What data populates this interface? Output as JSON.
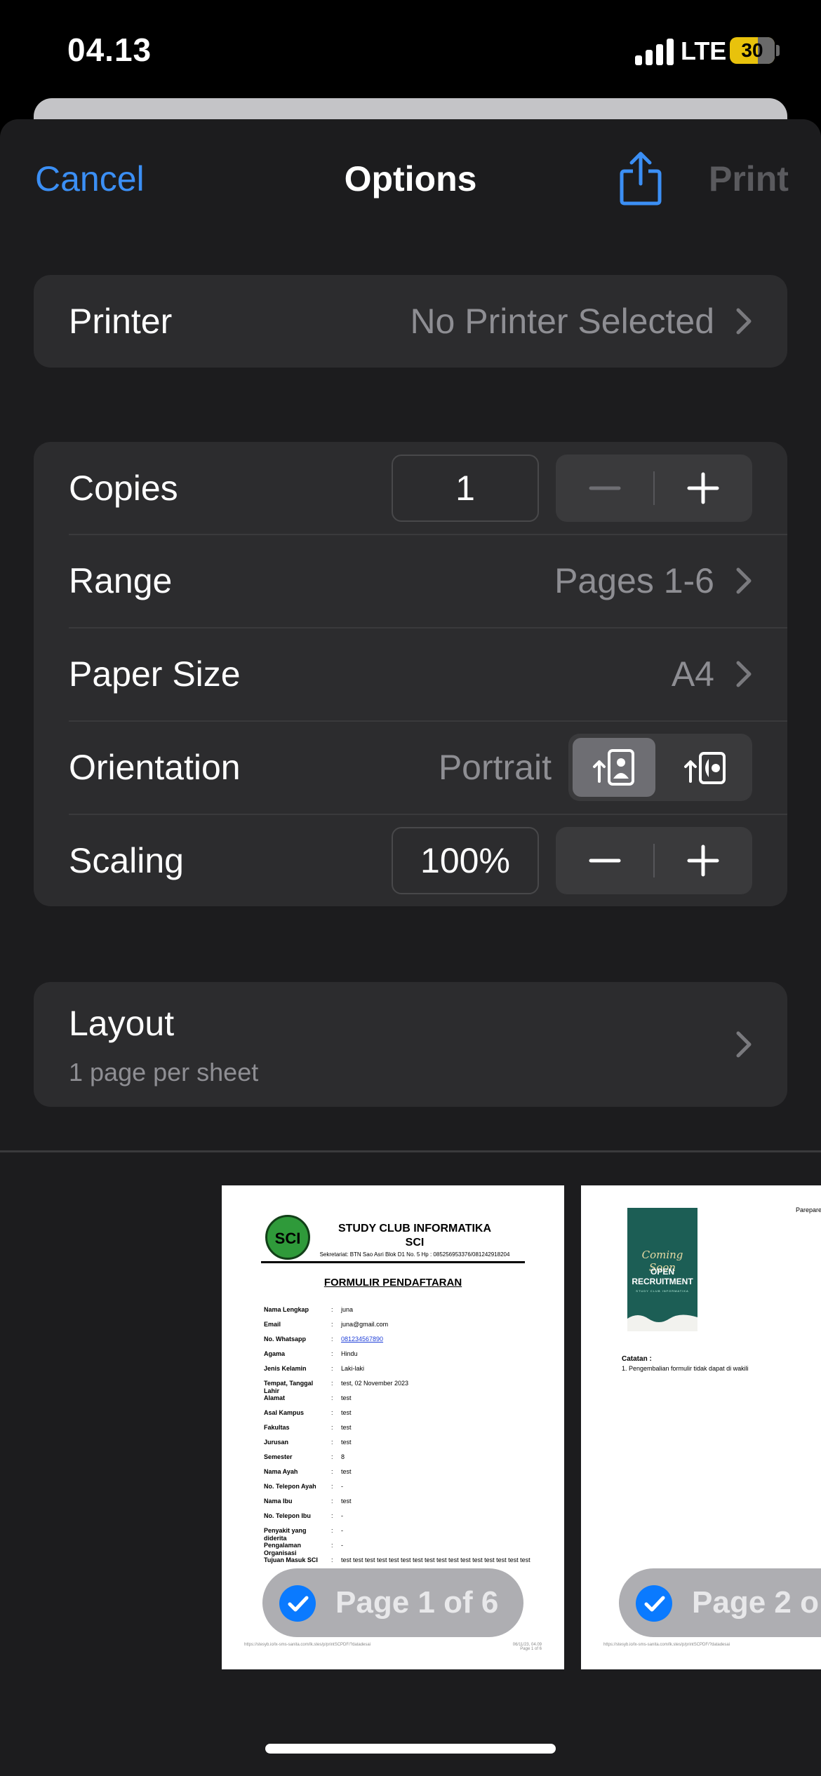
{
  "status_bar": {
    "time": "04.13",
    "network": "LTE",
    "battery": "30"
  },
  "nav": {
    "cancel": "Cancel",
    "title": "Options",
    "share_icon": "share-icon",
    "print": "Print"
  },
  "printer": {
    "label": "Printer",
    "value": "No Printer Selected"
  },
  "options": {
    "copies": {
      "label": "Copies",
      "value": "1"
    },
    "range": {
      "label": "Range",
      "value": "Pages 1-6"
    },
    "paper_size": {
      "label": "Paper Size",
      "value": "A4"
    },
    "orientation": {
      "label": "Orientation",
      "value": "Portrait",
      "selected": "portrait"
    },
    "scaling": {
      "label": "Scaling",
      "value": "100%"
    }
  },
  "layout": {
    "label": "Layout",
    "value": "1 page per sheet"
  },
  "previews": [
    {
      "badge": "Page 1 of 6",
      "org_line1": "STUDY CLUB INFORMATIKA",
      "org_line2": "SCI",
      "logo_text": "SCI",
      "address": "Sekretariat: BTN Sao Asri Blok D1 No. 5 Hp : 085256953376/081242918204",
      "form_title": "FORMULIR PENDAFTARAN",
      "fields": [
        {
          "key": "Nama Lengkap",
          "value": "juna"
        },
        {
          "key": "Email",
          "value": "juna@gmail.com"
        },
        {
          "key": "No. Whatsapp",
          "value": "081234567890"
        },
        {
          "key": "Agama",
          "value": "Hindu"
        },
        {
          "key": "Jenis Kelamin",
          "value": "Laki-laki"
        },
        {
          "key": "Tempat, Tanggal Lahir",
          "value": "test, 02 November 2023"
        },
        {
          "key": "Alamat",
          "value": "test"
        },
        {
          "key": "Asal Kampus",
          "value": "test"
        },
        {
          "key": "Fakultas",
          "value": "test"
        },
        {
          "key": "Jurusan",
          "value": "test"
        },
        {
          "key": "Semester",
          "value": "8"
        },
        {
          "key": "Nama Ayah",
          "value": "test"
        },
        {
          "key": "No. Telepon Ayah",
          "value": "-"
        },
        {
          "key": "Nama Ibu",
          "value": "test"
        },
        {
          "key": "No. Telepon Ibu",
          "value": "-"
        },
        {
          "key": "Penyakit yang diderita",
          "value": "-"
        },
        {
          "key": "Pengalaman Organisasi",
          "value": "-"
        },
        {
          "key": "Tujuan Masuk SCI",
          "value": "test test test test test test test test test test test test test test test test"
        }
      ],
      "footer_left": "https://stesyb.io/lx-sms-sanita.com/lk.stes/p/printSCPDF/?datadesai",
      "footer_right_1": "06/11/23, 04.09",
      "footer_right_2": "Page 1 of 6"
    },
    {
      "badge": "Page 2 o",
      "prep": "Parepare",
      "poster_title": "Coming Soon",
      "poster_open_1": "OPEN",
      "poster_open_2": "RECRUITMENT",
      "poster_sub": "STUDY CLUB INFORMATIKA",
      "note_label": "Catatan :",
      "note_text": "1. Pengembalian formulir tidak dapat di wakili",
      "footer_left": "https://stesyb.io/lx-sms-sanita.com/lk.stes/p/printSCPDF/?datadesai"
    }
  ],
  "colors": {
    "accent": "#3b8ff5",
    "sheet": "#1c1c1e",
    "group": "#2c2c2e",
    "battery": "#e8c20c",
    "check": "#0a7aff"
  }
}
